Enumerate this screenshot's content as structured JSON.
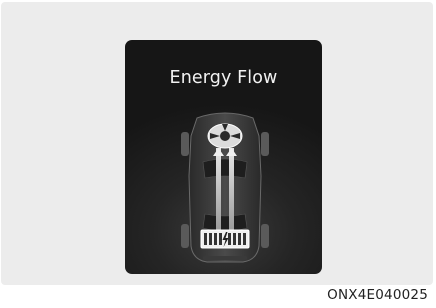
{
  "screen": {
    "title": "Energy Flow",
    "illustration": "vehicle-energy-flow-battery-to-motor",
    "battery_icon": "battery-lightning-icon",
    "motor_icon": "motor-icon"
  },
  "caption": {
    "image_code": "ONX4E040025"
  },
  "colors": {
    "panel_background": "#ececec",
    "screen_background": "#1c1c1c",
    "text_light": "#f2f2f2",
    "caption_text": "#222222"
  }
}
